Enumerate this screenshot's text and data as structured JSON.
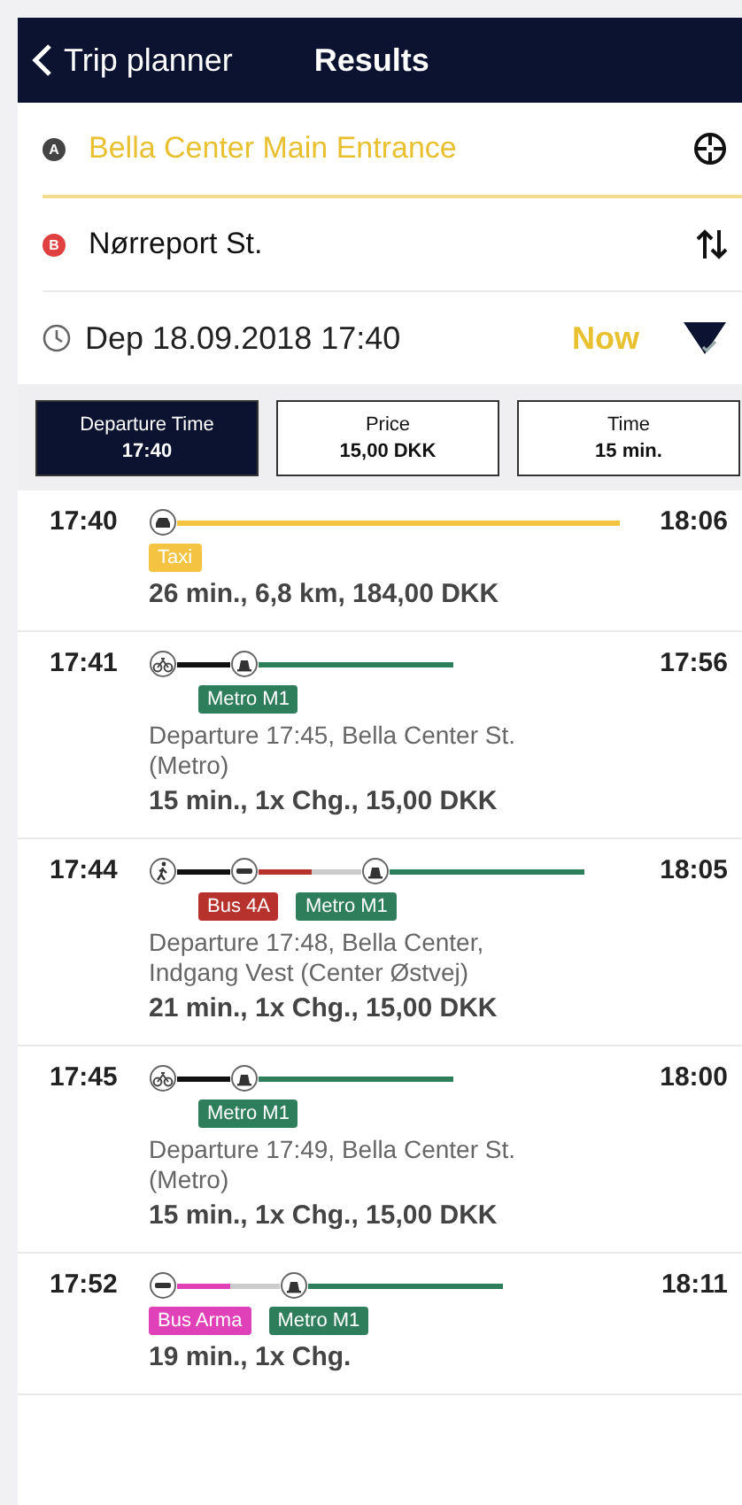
{
  "header": {
    "back_label": "Trip planner",
    "title": "Results"
  },
  "route": {
    "from": {
      "marker": "A",
      "text": "Bella Center Main Entrance"
    },
    "to": {
      "marker": "B",
      "text": "Nørreport St."
    }
  },
  "departure": {
    "text": "Dep 18.09.2018 17:40",
    "now_label": "Now"
  },
  "sort_tabs": [
    {
      "label": "Departure Time",
      "value": "17:40",
      "selected": true
    },
    {
      "label": "Price",
      "value": "15,00 DKK",
      "selected": false
    },
    {
      "label": "Time",
      "value": "15 min.",
      "selected": false
    }
  ],
  "trips": [
    {
      "start": "17:40",
      "end": "18:06",
      "legs": [
        {
          "kind": "taxi",
          "tag": "Taxi",
          "color": "#f5c342"
        }
      ],
      "summary": "26 min.,  6,8 km,  184,00 DKK"
    },
    {
      "start": "17:41",
      "end": "17:56",
      "legs": [
        {
          "kind": "bike",
          "color": "#111111"
        },
        {
          "kind": "metro",
          "tag": "Metro M1",
          "color": "#2e7d5b"
        }
      ],
      "details": "Departure 17:45, Bella Center St. (Metro)",
      "summary": "15 min.,  1x Chg.,  15,00 DKK"
    },
    {
      "start": "17:44",
      "end": "18:05",
      "legs": [
        {
          "kind": "walk",
          "color": "#111111"
        },
        {
          "kind": "bus",
          "tag": "Bus 4A",
          "color": "#b8322d"
        },
        {
          "kind": "metro",
          "tag": "Metro M1",
          "color": "#2e7d5b"
        }
      ],
      "details": "Departure 17:48, Bella Center, Indgang Vest (Center Østvej)",
      "summary": "21 min.,  1x Chg.,  15,00 DKK"
    },
    {
      "start": "17:45",
      "end": "18:00",
      "legs": [
        {
          "kind": "bike",
          "color": "#111111"
        },
        {
          "kind": "metro",
          "tag": "Metro M1",
          "color": "#2e7d5b"
        }
      ],
      "details": "Departure 17:49, Bella Center St. (Metro)",
      "summary": "15 min.,  1x Chg.,  15,00 DKK"
    },
    {
      "start": "17:52",
      "end": "18:11",
      "legs": [
        {
          "kind": "bus",
          "tag": "Bus Arma",
          "color": "#e040b8"
        },
        {
          "kind": "metro",
          "tag": "Metro M1",
          "color": "#2e7d5b"
        }
      ],
      "summary": "19 min.,  1x Chg."
    }
  ]
}
